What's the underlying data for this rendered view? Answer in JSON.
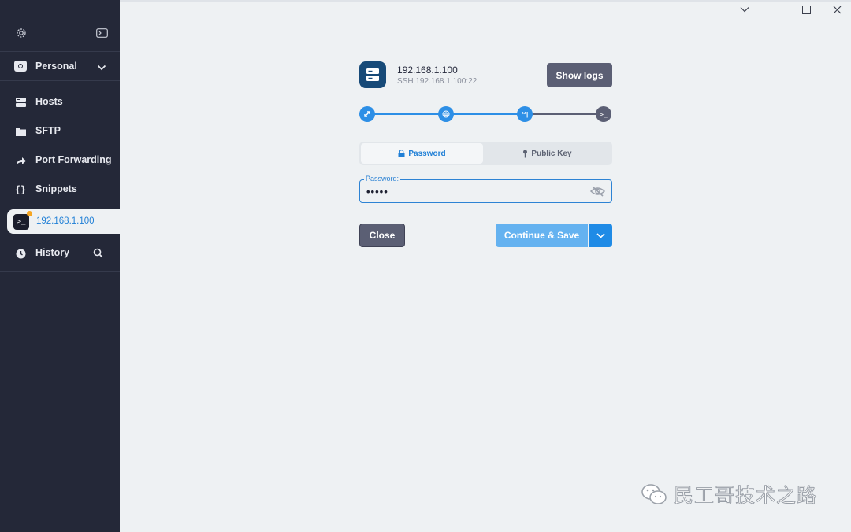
{
  "sidebar": {
    "vault": {
      "label": "Personal"
    },
    "items": [
      {
        "label": "Hosts"
      },
      {
        "label": "SFTP"
      },
      {
        "label": "Port Forwarding"
      },
      {
        "label": "Snippets"
      }
    ],
    "active_tab": {
      "label": "192.168.1.100",
      "badge_color": "#f6a623"
    },
    "history": {
      "label": "History"
    }
  },
  "host": {
    "title": "192.168.1.100",
    "subtitle": "SSH 192.168.1.100:22"
  },
  "toolbar": {
    "show_logs_label": "Show logs"
  },
  "progress": {
    "steps": [
      "connect-icon",
      "fingerprint-icon",
      "password-icon",
      "terminal-icon"
    ],
    "completed_steps": 3,
    "colors": {
      "done": "#2d8fe6",
      "pending": "#5b5f74"
    }
  },
  "auth": {
    "tabs": [
      {
        "label": "Password",
        "icon": "lock-icon",
        "active": true
      },
      {
        "label": "Public Key",
        "icon": "key-icon",
        "active": false
      }
    ],
    "password": {
      "label": "Password:",
      "value": "•••••"
    }
  },
  "actions": {
    "close_label": "Close",
    "save_label": "Continue & Save"
  },
  "watermark": {
    "text": "民工哥技术之路"
  }
}
